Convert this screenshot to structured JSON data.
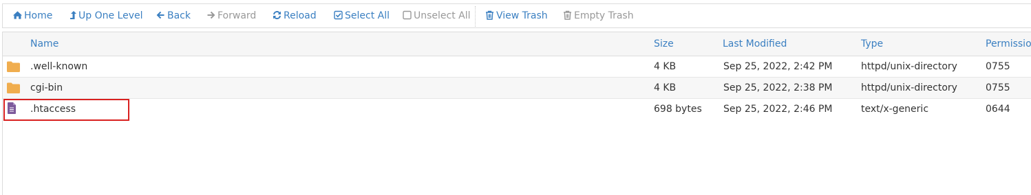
{
  "toolbar": {
    "home": "Home",
    "up": "Up One Level",
    "back": "Back",
    "forward": "Forward",
    "reload": "Reload",
    "select_all": "Select All",
    "unselect_all": "Unselect All",
    "view_trash": "View Trash",
    "empty_trash": "Empty Trash"
  },
  "columns": {
    "name": "Name",
    "size": "Size",
    "modified": "Last Modified",
    "type": "Type",
    "permissions": "Permissions"
  },
  "files": [
    {
      "name": ".well-known",
      "size": "4 KB",
      "modified": "Sep 25, 2022, 2:42 PM",
      "type": "httpd/unix-directory",
      "perms": "0755",
      "icon": "folder-icon"
    },
    {
      "name": "cgi-bin",
      "size": "4 KB",
      "modified": "Sep 25, 2022, 2:38 PM",
      "type": "httpd/unix-directory",
      "perms": "0755",
      "icon": "folder-icon"
    },
    {
      "name": ".htaccess",
      "size": "698 bytes",
      "modified": "Sep 25, 2022, 2:46 PM",
      "type": "text/x-generic",
      "perms": "0644",
      "icon": "text-file-icon"
    }
  ],
  "colors": {
    "link": "#3a7fc1",
    "disabled": "#999999",
    "folder": "#f0ad4e",
    "file": "#7d5a9b",
    "highlight": "#d9201f"
  }
}
